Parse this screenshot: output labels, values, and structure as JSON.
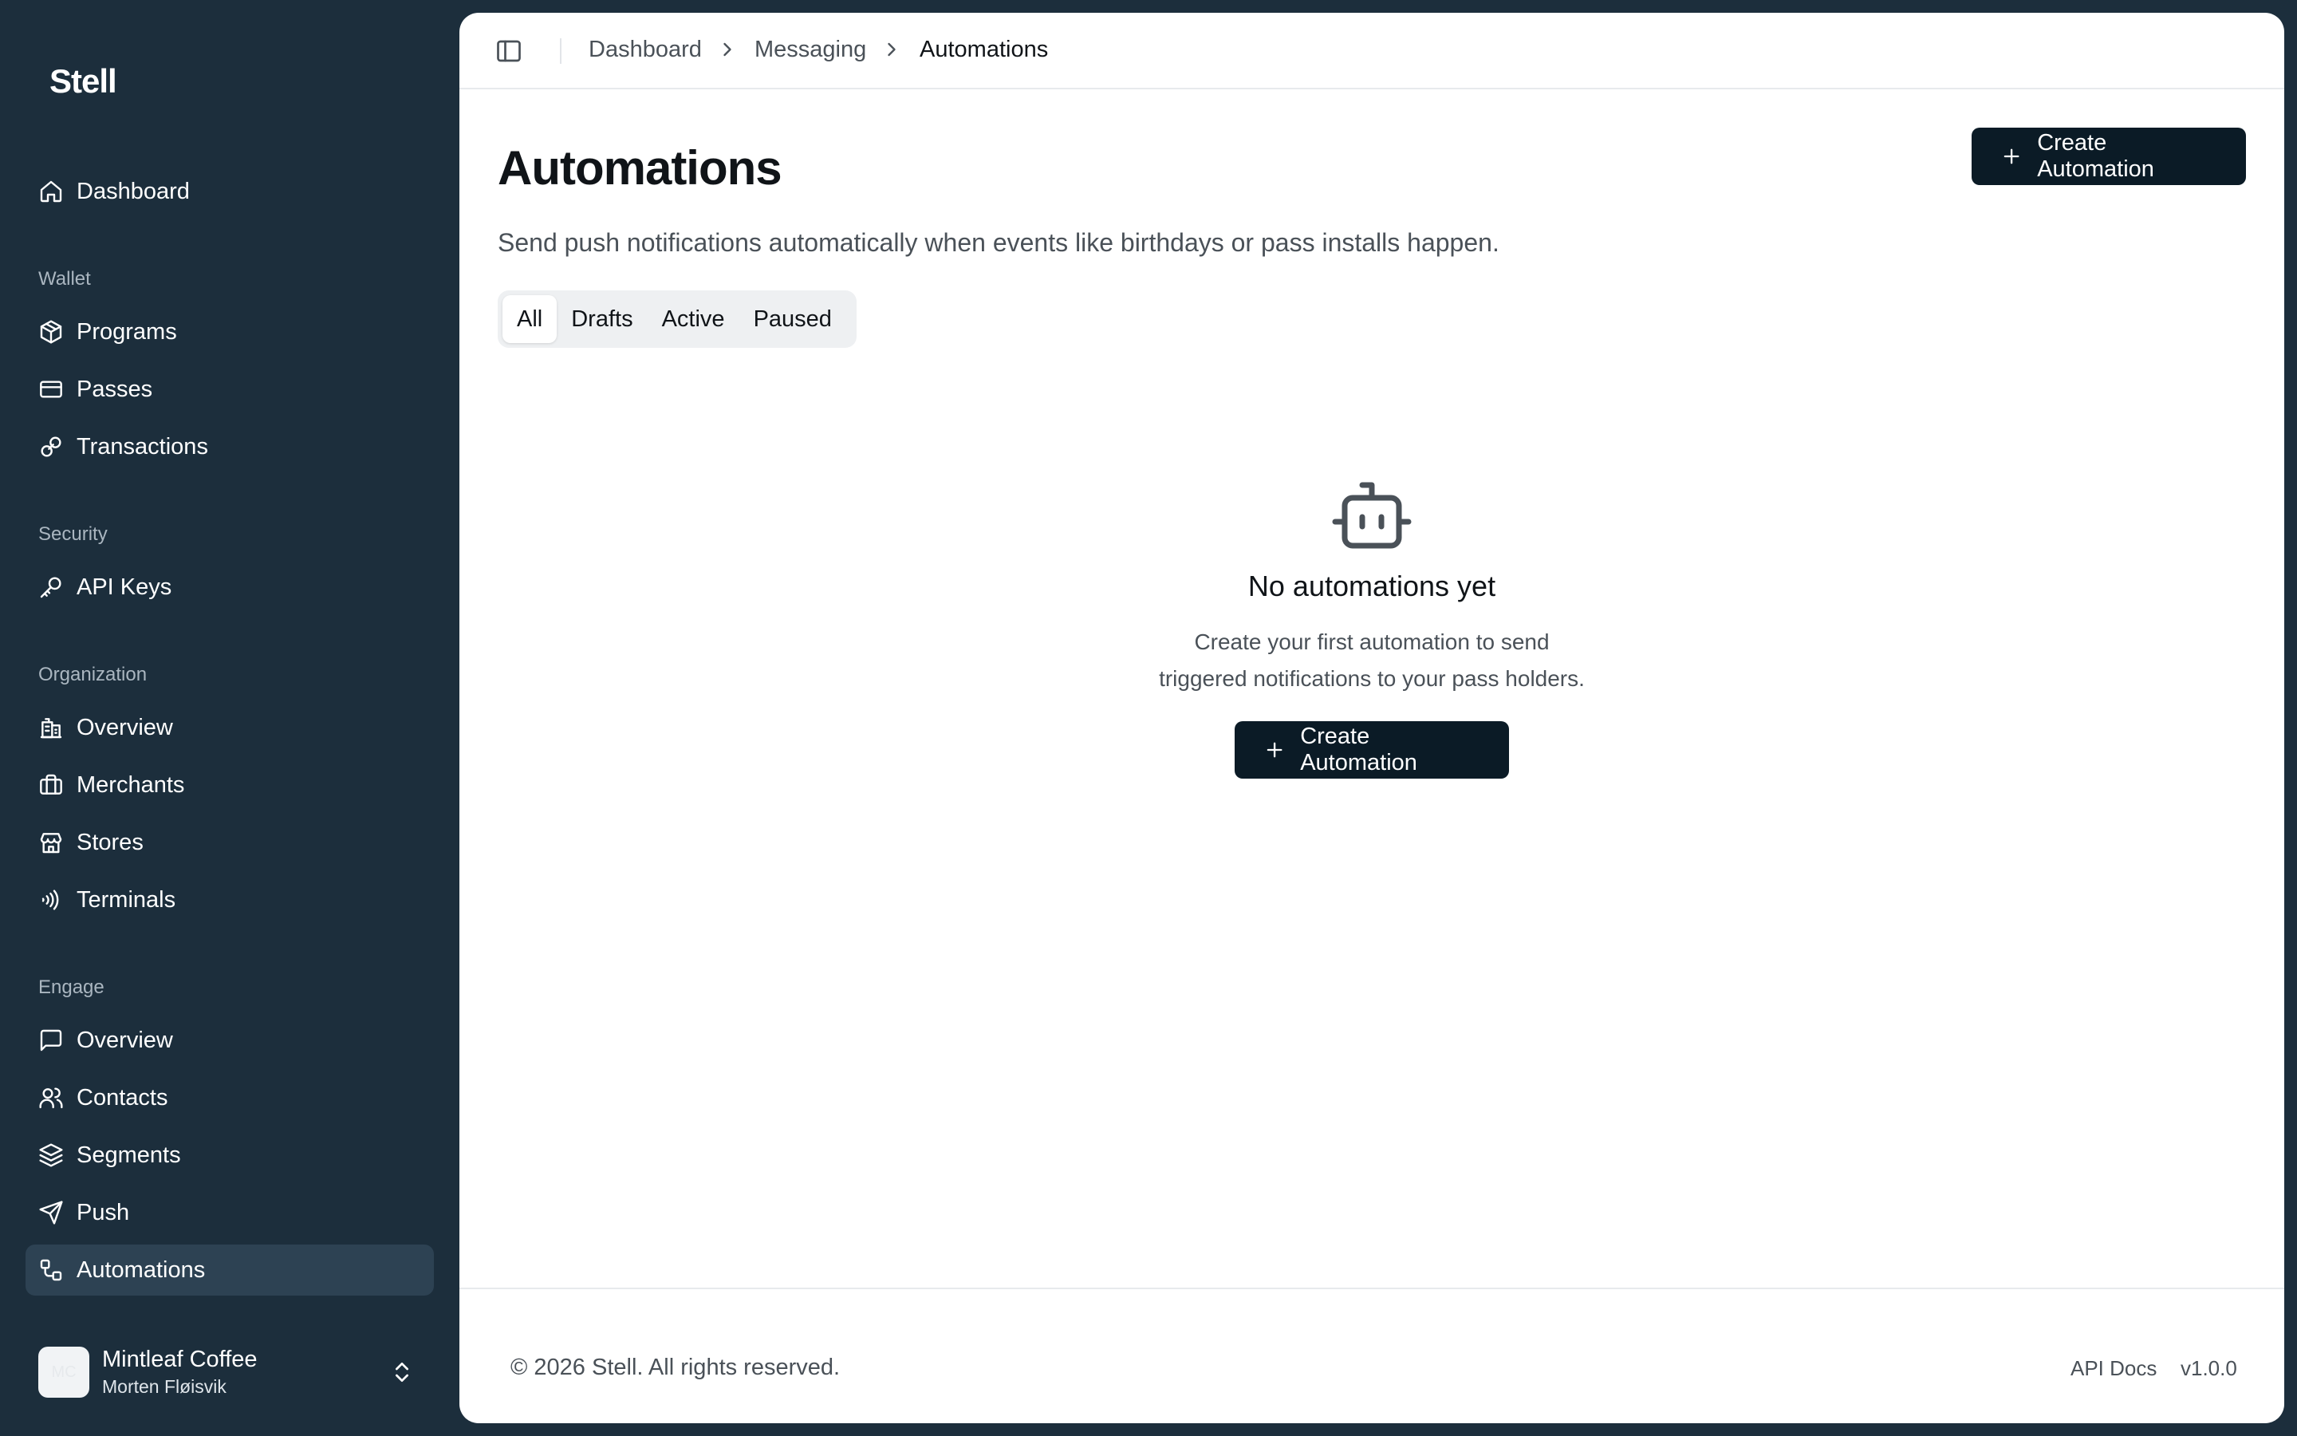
{
  "app": {
    "logo": "Stell"
  },
  "sidebar": {
    "top_items": [
      {
        "label": "Dashboard",
        "icon": "home-icon"
      }
    ],
    "sections": [
      {
        "title": "Wallet",
        "items": [
          {
            "label": "Programs",
            "icon": "box-icon"
          },
          {
            "label": "Passes",
            "icon": "card-icon"
          },
          {
            "label": "Transactions",
            "icon": "link-icon"
          }
        ]
      },
      {
        "title": "Security",
        "items": [
          {
            "label": "API Keys",
            "icon": "key-icon"
          }
        ]
      },
      {
        "title": "Organization",
        "items": [
          {
            "label": "Overview",
            "icon": "building-icon"
          },
          {
            "label": "Merchants",
            "icon": "briefcase-icon"
          },
          {
            "label": "Stores",
            "icon": "store-icon"
          },
          {
            "label": "Terminals",
            "icon": "contactless-icon"
          }
        ]
      },
      {
        "title": "Engage",
        "items": [
          {
            "label": "Overview",
            "icon": "message-square-icon"
          },
          {
            "label": "Contacts",
            "icon": "users-icon"
          },
          {
            "label": "Segments",
            "icon": "layers-icon"
          },
          {
            "label": "Push",
            "icon": "send-icon"
          },
          {
            "label": "Automations",
            "icon": "workflow-icon",
            "active": true
          }
        ]
      }
    ],
    "account": {
      "avatar_initials": "MC",
      "name": "Mintleaf Coffee",
      "user": "Morten Fløisvik"
    }
  },
  "breadcrumb": [
    "Dashboard",
    "Messaging",
    "Automations"
  ],
  "page": {
    "title": "Automations",
    "subtitle": "Send push notifications automatically when events like birthdays or pass installs happen.",
    "create_button": "Create Automation"
  },
  "tabs": [
    {
      "label": "All",
      "active": true
    },
    {
      "label": "Drafts"
    },
    {
      "label": "Active"
    },
    {
      "label": "Paused"
    }
  ],
  "empty_state": {
    "icon": "bot-icon",
    "title": "No automations yet",
    "text_line1": "Create your first automation to send",
    "text_line2": "triggered notifications to your pass holders.",
    "button": "Create Automation"
  },
  "footer": {
    "copyright": "© 2026 Stell. All rights reserved.",
    "api_docs": "API Docs",
    "version": "v1.0.0"
  },
  "colors": {
    "sidebar_bg": "#1c2e3c",
    "sidebar_active": "#2d4253",
    "button_dark": "#0b1b26",
    "page_bg": "#ffffff"
  }
}
